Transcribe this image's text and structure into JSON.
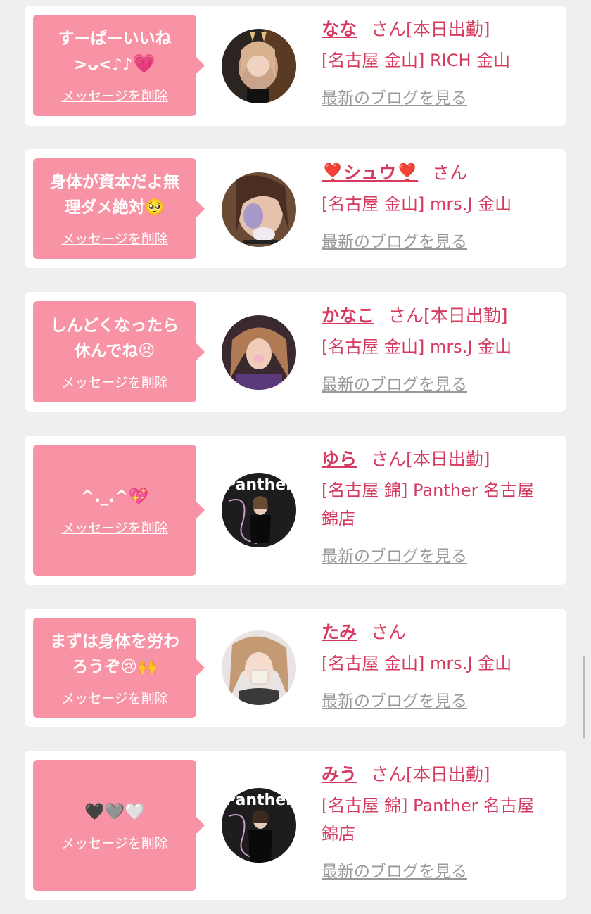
{
  "cards": [
    {
      "message": "すーぱーいいね\n>ᴗ<♪♪",
      "message_emoji": "💗",
      "delete_label": "メッセージを削除",
      "name": "なな",
      "san": "さん",
      "status": "[本日出勤]",
      "shop": "[名古屋 金山] RICH 金山",
      "blog_label": "最新のブログを見る"
    },
    {
      "message": "身体が資本だよ無\n理ダメ絶対🥺",
      "message_emoji": "",
      "delete_label": "メッセージを削除",
      "name": "❣️シュウ❣️",
      "san": "さん",
      "status": "",
      "shop": "[名古屋 金山] mrs.J 金山",
      "blog_label": "最新のブログを見る"
    },
    {
      "message": "しんどくなったら\n休んでね😣",
      "message_emoji": "",
      "delete_label": "メッセージを削除",
      "name": "かなこ",
      "san": "さん",
      "status": "[本日出勤]",
      "shop": "[名古屋 金山] mrs.J 金山",
      "blog_label": "最新のブログを見る"
    },
    {
      "message": "^._.^💖",
      "message_emoji": "",
      "delete_label": "メッセージを削除",
      "name": "ゆら",
      "san": "さん",
      "status": "[本日出勤]",
      "shop": "[名古屋 錦] Panther 名古屋\n錦店",
      "blog_label": "最新のブログを見る"
    },
    {
      "message": "まずは身体を労わ\nろうぞ😢🙌",
      "message_emoji": "",
      "delete_label": "メッセージを削除",
      "name": "たみ",
      "san": "さん",
      "status": "",
      "shop": "[名古屋 金山] mrs.J 金山",
      "blog_label": "最新のブログを見る"
    },
    {
      "message": "🖤🩶🤍",
      "message_emoji": "",
      "delete_label": "メッセージを削除",
      "name": "みう",
      "san": "さん",
      "status": "[本日出勤]",
      "shop": "[名古屋 錦] Panther 名古屋\n錦店",
      "blog_label": "最新のブログを見る"
    }
  ],
  "avatar_logo_text": "Panther",
  "colors": {
    "accent_pink": "#d63a5f",
    "bubble_pink": "#f893a6",
    "link_gray": "#999999",
    "background": "#efefef"
  }
}
